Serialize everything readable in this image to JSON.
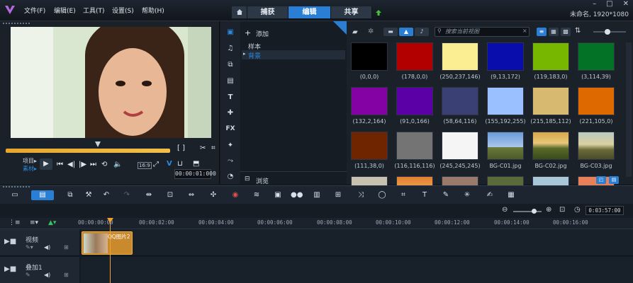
{
  "menu": [
    "文件(F)",
    "编辑(E)",
    "工具(T)",
    "设置(S)",
    "帮助(H)"
  ],
  "mode_tabs": [
    {
      "label": "捕获",
      "active": false
    },
    {
      "label": "编辑",
      "active": true
    },
    {
      "label": "共享",
      "active": false
    }
  ],
  "project_info": "未命名, 1920*1080",
  "player": {
    "mode_labels": [
      "项目▸",
      "素材▸"
    ],
    "aspect": "16:9",
    "timecode": "00:00:01:000"
  },
  "library": {
    "add_label": "添加",
    "tree": [
      {
        "label": "样本",
        "selected": false
      },
      {
        "label": "背景",
        "selected": true
      }
    ],
    "browse_label": "浏览",
    "search_placeholder": "搜索当前视图",
    "swatches": [
      {
        "label": "(0,0,0)",
        "color": "#000000"
      },
      {
        "label": "(178,0,0)",
        "color": "#b20000"
      },
      {
        "label": "(250,237,146)",
        "color": "#faed92"
      },
      {
        "label": "(9,13,172)",
        "color": "#090dac"
      },
      {
        "label": "(119,183,0)",
        "color": "#77b700"
      },
      {
        "label": "(3,114,39)",
        "color": "#037227"
      },
      {
        "label": "(132,2,164)",
        "color": "#8402a4"
      },
      {
        "label": "(91,0,166)",
        "color": "#5b00a6"
      },
      {
        "label": "(58,64,116)",
        "color": "#3a4074"
      },
      {
        "label": "(155,192,255)",
        "color": "#9bc0ff"
      },
      {
        "label": "(215,185,112)",
        "color": "#d7b970"
      },
      {
        "label": "(221,105,0)",
        "color": "#dd6900"
      },
      {
        "label": "(111,38,0)",
        "color": "#6f2600"
      },
      {
        "label": "(116,116,116)",
        "color": "#747474"
      },
      {
        "label": "(245,245,245)",
        "color": "#f5f5f5"
      },
      {
        "label": "BG-C01.jpg",
        "color": "#5a7aa8"
      },
      {
        "label": "BG-C02.jpg",
        "color": "#8a7a3a"
      },
      {
        "label": "BG-C03.jpg",
        "color": "#8a8a5a"
      }
    ],
    "partial_row_colors": [
      "#c8c0b0",
      "#e08030",
      "#9a7a6a",
      "#5a6a3a",
      "#a8c8d8",
      "#e8805a"
    ]
  },
  "timeline": {
    "ruler": [
      "00:00:00:00",
      "00:00:02:00",
      "00:00:04:00",
      "00:00:06:00",
      "00:00:08:00",
      "00:00:10:00",
      "00:00:12:00",
      "00:00:14:00",
      "00:00:16:00"
    ],
    "zoom_timecode": "0:03:57:00",
    "tracks": [
      {
        "name": "视频"
      },
      {
        "name": "叠加1"
      }
    ],
    "clip_label": "QQ图片2"
  }
}
